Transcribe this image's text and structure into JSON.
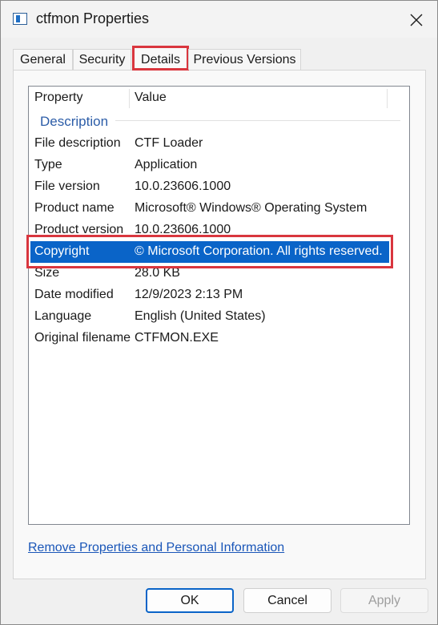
{
  "window": {
    "title": "ctfmon Properties",
    "app_icon": "properties-window-icon",
    "close_icon": "close-icon"
  },
  "tabs": [
    {
      "label": "General",
      "active": false
    },
    {
      "label": "Security",
      "active": false
    },
    {
      "label": "Details",
      "active": true
    },
    {
      "label": "Previous Versions",
      "active": false
    }
  ],
  "details": {
    "columns": {
      "property": "Property",
      "value": "Value"
    },
    "group": "Description",
    "rows": [
      {
        "property": "File description",
        "value": "CTF Loader"
      },
      {
        "property": "Type",
        "value": "Application"
      },
      {
        "property": "File version",
        "value": "10.0.23606.1000"
      },
      {
        "property": "Product name",
        "value": "Microsoft® Windows® Operating System"
      },
      {
        "property": "Product version",
        "value": "10.0.23606.1000"
      },
      {
        "property": "Copyright",
        "value": "© Microsoft Corporation. All rights reserved.",
        "selected": true
      },
      {
        "property": "Size",
        "value": "28.0 KB"
      },
      {
        "property": "Date modified",
        "value": "12/9/2023 2:13 PM"
      },
      {
        "property": "Language",
        "value": "English (United States)"
      },
      {
        "property": "Original filename",
        "value": "CTFMON.EXE"
      }
    ]
  },
  "link": {
    "label": "Remove Properties and Personal Information"
  },
  "buttons": {
    "ok": "OK",
    "cancel": "Cancel",
    "apply": "Apply"
  },
  "colors": {
    "accent": "#0a64c8",
    "highlight_box": "#d9363e",
    "link": "#1a56b8"
  }
}
